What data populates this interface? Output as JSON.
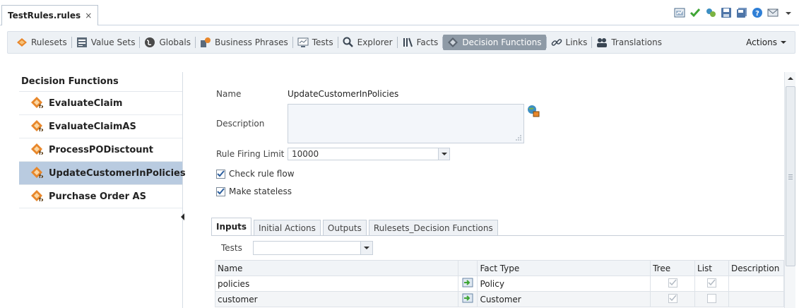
{
  "document_tab": {
    "label": "TestRules.rules",
    "close": "×"
  },
  "nav": {
    "items": [
      {
        "label": "Rulesets",
        "icon": "ruleset-icon"
      },
      {
        "label": "Value Sets",
        "icon": "value-sets-icon"
      },
      {
        "label": "Globals",
        "icon": "globe-icon"
      },
      {
        "label": "Business Phrases",
        "icon": "phrases-icon"
      },
      {
        "label": "Tests",
        "icon": "tests-icon"
      },
      {
        "label": "Explorer",
        "icon": "search-icon"
      },
      {
        "label": "Facts",
        "icon": "facts-icon"
      },
      {
        "label": "Decision Functions",
        "icon": "decision-icon"
      },
      {
        "label": "Links",
        "icon": "link-icon"
      },
      {
        "label": "Translations",
        "icon": "translations-icon"
      }
    ],
    "active": "Decision Functions",
    "actions_label": "Actions"
  },
  "left_panel": {
    "title": "Decision Functions",
    "items": [
      {
        "label": "EvaluateClaim"
      },
      {
        "label": "EvaluateClaimAS"
      },
      {
        "label": "ProcessPODisctount"
      },
      {
        "label": "UpdateCustomerInPolicies"
      },
      {
        "label": "Purchase Order AS"
      }
    ],
    "selected": "UpdateCustomerInPolicies"
  },
  "detail": {
    "name_label": "Name",
    "name_value": "UpdateCustomerInPolicies",
    "description_label": "Description",
    "description_value": "",
    "firing_limit_label": "Rule Firing Limit",
    "firing_limit_value": "10000",
    "check_rule_flow": {
      "label": "Check rule flow",
      "checked": true
    },
    "make_stateless": {
      "label": "Make stateless",
      "checked": true
    }
  },
  "subtabs": {
    "items": [
      "Inputs",
      "Initial Actions",
      "Outputs",
      "Rulesets_Decision Functions"
    ],
    "active": "Inputs"
  },
  "tests_row": {
    "label": "Tests",
    "value": ""
  },
  "inputs_table": {
    "headers": [
      "Name",
      "",
      "Fact Type",
      "Tree",
      "List",
      "Description"
    ],
    "rows": [
      {
        "name": "policies",
        "fact_type": "Policy",
        "tree": true,
        "list": true,
        "description": ""
      },
      {
        "name": "customer",
        "fact_type": "Customer",
        "tree": true,
        "list": false,
        "description": ""
      }
    ]
  },
  "colors": {
    "active_nav": "#8e9aa6",
    "selected_item": "#b9cbe0",
    "nav_bg": "#edf1f5",
    "icon_orange": "#e8872b",
    "check_green": "#3fa535"
  }
}
